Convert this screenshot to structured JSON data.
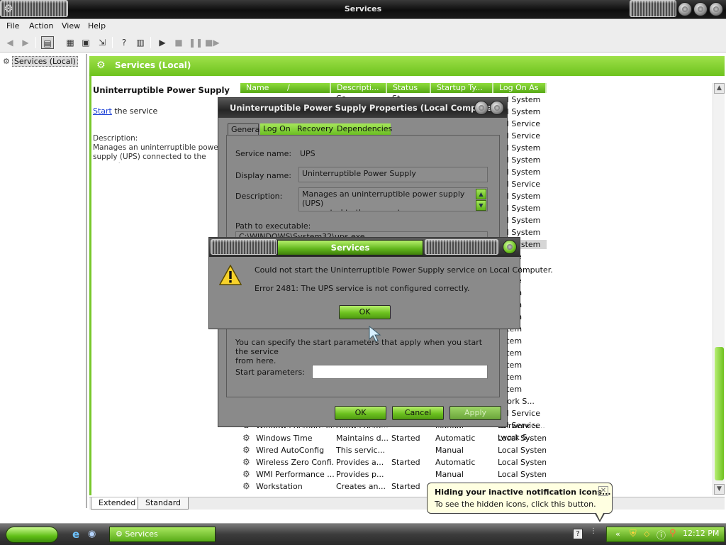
{
  "window": {
    "title": "Services",
    "colors": {
      "accent_green": "#6dc21d",
      "title_dark": "#0d0d0d",
      "tooltip_bg": "#ffffe1"
    }
  },
  "menu": {
    "items": [
      "File",
      "Action",
      "View",
      "Help"
    ]
  },
  "toolbar": {
    "icons": [
      "back-arrow-icon",
      "forward-arrow-icon",
      "show-hide-tree-icon",
      "up-one-level-icon",
      "properties-icon",
      "export-list-icon",
      "help-icon",
      "console-tree-icon",
      "play-icon",
      "stop-icon",
      "pause-icon",
      "restart-icon"
    ]
  },
  "tree": {
    "node_label": "Services (Local)"
  },
  "pane": {
    "header": "Services (Local)",
    "service_title": "Uninterruptible Power Supply",
    "start_link": "Start",
    "start_suffix": " the service",
    "description_label": "Description:",
    "description_text": "Manages an uninterruptible power supply (UPS) connected to the computer."
  },
  "list": {
    "columns": [
      "Name",
      "Descripti...",
      "Status",
      "Startup Ty...",
      "Log On As"
    ],
    "name_sort_indicator": "/",
    "partial_top": {
      "description": "Co",
      "status": "St"
    },
    "visible_logon_column": [
      "cal System",
      "cal System",
      "cal Service",
      "cal Service",
      "cal System",
      "cal System",
      "cal System",
      "cal Service",
      "cal System",
      "cal System",
      "cal System",
      "cal System",
      "cal System",
      "ervice",
      "ervice",
      "ervice",
      "ystem",
      "ystem",
      "ystem",
      "ystem",
      "ystem",
      "ystem",
      "ystem",
      "ystem",
      "ystem",
      "twork S...",
      "cal Service",
      "cal Service",
      "twork S..."
    ],
    "rows": [
      {
        "name": "Windows Remote M...",
        "description": "Allows Rem...",
        "status": "",
        "startup": "Manual",
        "logon": "Network S..."
      },
      {
        "name": "Windows Time",
        "description": "Maintains d...",
        "status": "Started",
        "startup": "Automatic",
        "logon": "Local System"
      },
      {
        "name": "Wired AutoConfig",
        "description": "This servic...",
        "status": "",
        "startup": "Manual",
        "logon": "Local System"
      },
      {
        "name": "Wireless Zero Confi...",
        "description": "Provides a...",
        "status": "Started",
        "startup": "Automatic",
        "logon": "Local System"
      },
      {
        "name": "WMI Performance ...",
        "description": "Provides p...",
        "status": "",
        "startup": "Manual",
        "logon": "Local System"
      },
      {
        "name": "Workstation",
        "description": "Creates an...",
        "status": "Started",
        "startup": "Automatic",
        "logon": "Local System"
      }
    ]
  },
  "view_tabs": [
    "Extended",
    "Standard"
  ],
  "properties_dialog": {
    "title": "Uninterruptible Power Supply Properties (Local Computer)",
    "tabs": [
      "General",
      "Log On",
      "Recovery",
      "Dependencies"
    ],
    "service_name_label": "Service name:",
    "service_name": "UPS",
    "display_name_label": "Display name:",
    "display_name": "Uninterruptible Power Supply",
    "description_label": "Description:",
    "description": "Manages an uninterruptible power supply (UPS)\nconnected to the computer.",
    "path_label": "Path to executable:",
    "path_value": "C:\\WINDOWS\\System32\\ups.exe",
    "start_params_help": "You can specify the start parameters that apply when you start the service\nfrom here.",
    "start_params_label": "Start parameters:",
    "start_params_value": "",
    "ok": "OK",
    "cancel": "Cancel",
    "apply": "Apply"
  },
  "error_dialog": {
    "title": "Services",
    "message": "Could not start the Uninterruptible Power Supply service on Local Computer.",
    "detail": "Error 2481: The UPS service is not configured correctly.",
    "ok": "OK"
  },
  "taskbar": {
    "task_label": "Services",
    "clock": "12:12 PM",
    "tooltip_title": "Hiding your inactive notification icons...",
    "tooltip_body": "To see the hidden icons, click this button."
  }
}
